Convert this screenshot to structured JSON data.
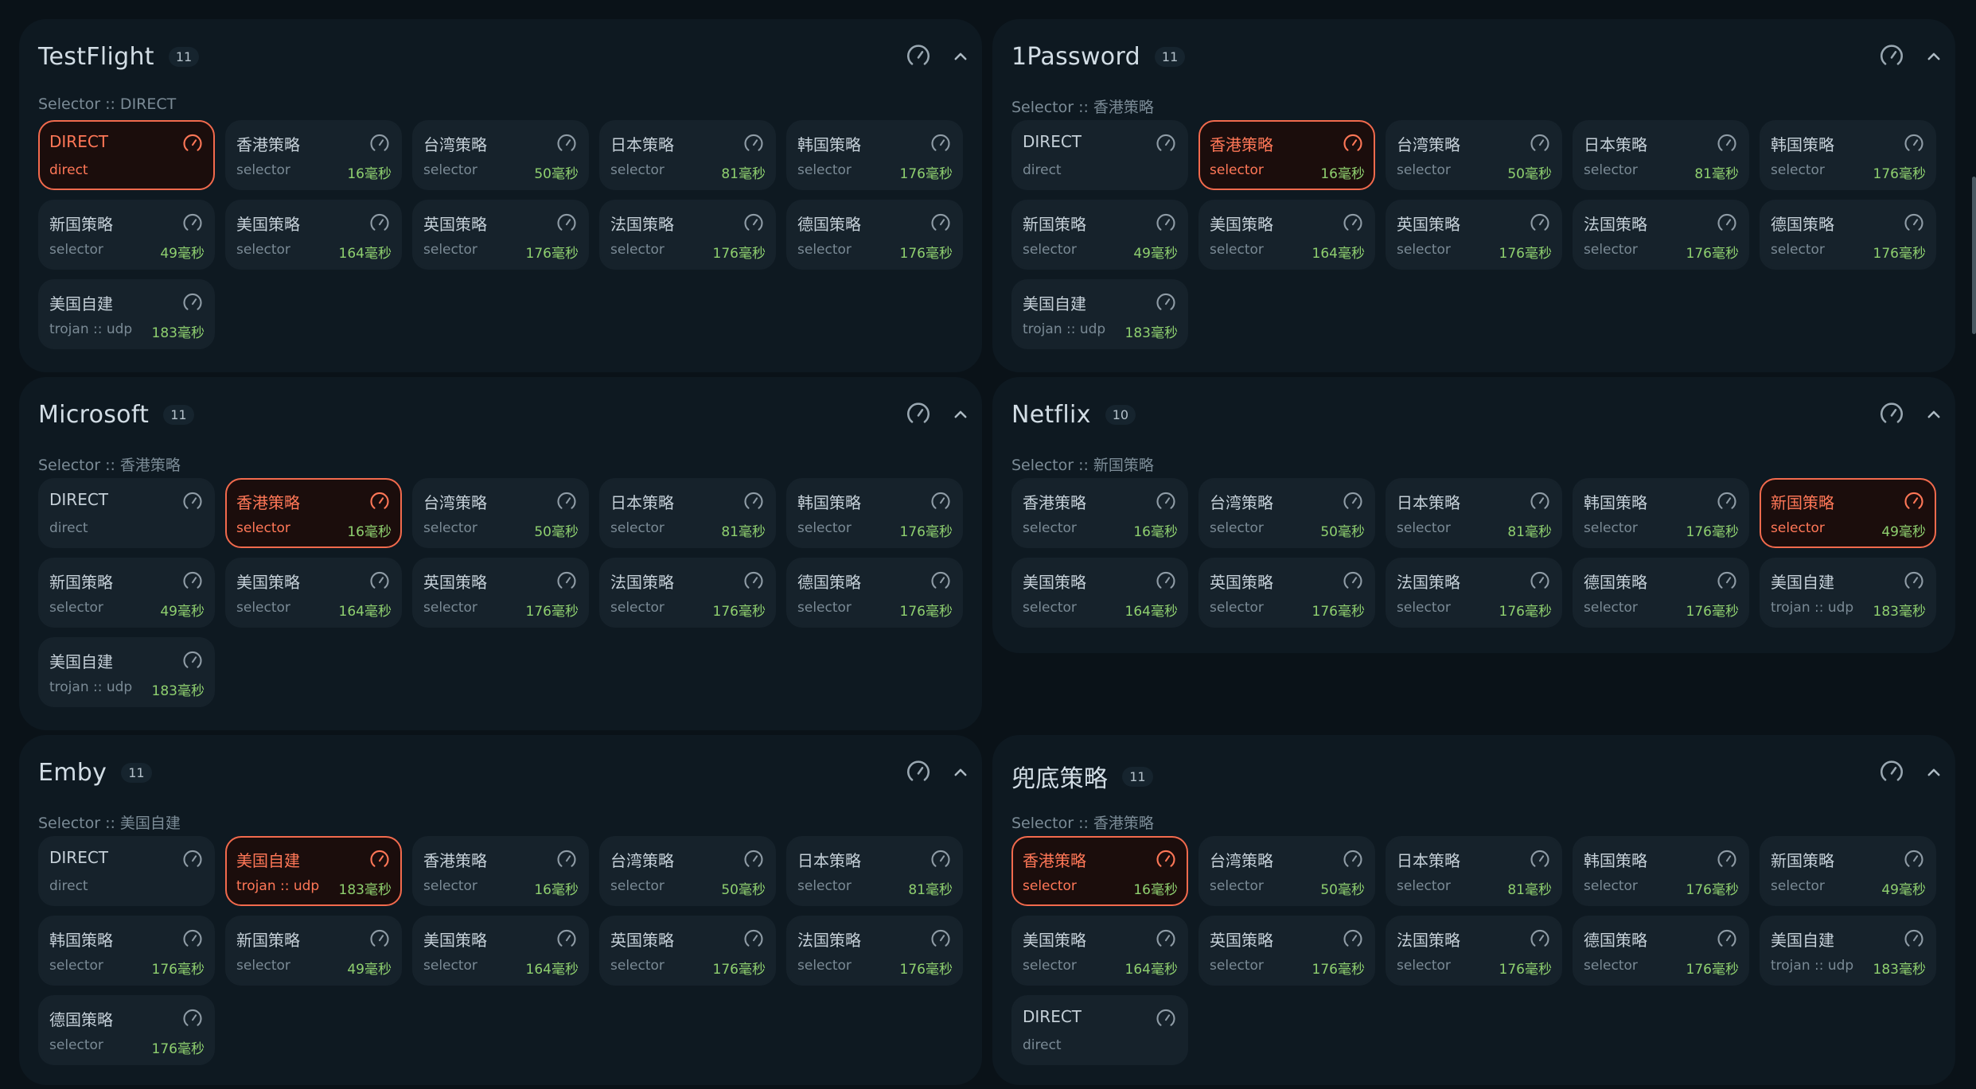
{
  "colors": {
    "background": "#0a1218",
    "panel": "#0e1921",
    "card": "#16222b",
    "selected_border": "#f26a4d",
    "selected_text": "#ff7757",
    "delay_text": "#8fd06f"
  },
  "icons": {
    "speed": "speedometer-icon",
    "collapse": "chevron-up-icon"
  },
  "groups": [
    {
      "title": "TestFlight",
      "count": "11",
      "subtitle": "Selector :: DIRECT",
      "proxies": [
        {
          "name": "DIRECT",
          "type": "direct",
          "delay": "",
          "selected": true
        },
        {
          "name": "香港策略",
          "type": "selector",
          "delay": "16毫秒",
          "selected": false
        },
        {
          "name": "台湾策略",
          "type": "selector",
          "delay": "50毫秒",
          "selected": false
        },
        {
          "name": "日本策略",
          "type": "selector",
          "delay": "81毫秒",
          "selected": false
        },
        {
          "name": "韩国策略",
          "type": "selector",
          "delay": "176毫秒",
          "selected": false
        },
        {
          "name": "新国策略",
          "type": "selector",
          "delay": "49毫秒",
          "selected": false
        },
        {
          "name": "美国策略",
          "type": "selector",
          "delay": "164毫秒",
          "selected": false
        },
        {
          "name": "英国策略",
          "type": "selector",
          "delay": "176毫秒",
          "selected": false
        },
        {
          "name": "法国策略",
          "type": "selector",
          "delay": "176毫秒",
          "selected": false
        },
        {
          "name": "德国策略",
          "type": "selector",
          "delay": "176毫秒",
          "selected": false
        },
        {
          "name": "美国自建",
          "type": "trojan :: udp",
          "delay": "183毫秒",
          "selected": false
        }
      ]
    },
    {
      "title": "1Password",
      "count": "11",
      "subtitle": "Selector :: 香港策略",
      "proxies": [
        {
          "name": "DIRECT",
          "type": "direct",
          "delay": "",
          "selected": false
        },
        {
          "name": "香港策略",
          "type": "selector",
          "delay": "16毫秒",
          "selected": true
        },
        {
          "name": "台湾策略",
          "type": "selector",
          "delay": "50毫秒",
          "selected": false
        },
        {
          "name": "日本策略",
          "type": "selector",
          "delay": "81毫秒",
          "selected": false
        },
        {
          "name": "韩国策略",
          "type": "selector",
          "delay": "176毫秒",
          "selected": false
        },
        {
          "name": "新国策略",
          "type": "selector",
          "delay": "49毫秒",
          "selected": false
        },
        {
          "name": "美国策略",
          "type": "selector",
          "delay": "164毫秒",
          "selected": false
        },
        {
          "name": "英国策略",
          "type": "selector",
          "delay": "176毫秒",
          "selected": false
        },
        {
          "name": "法国策略",
          "type": "selector",
          "delay": "176毫秒",
          "selected": false
        },
        {
          "name": "德国策略",
          "type": "selector",
          "delay": "176毫秒",
          "selected": false
        },
        {
          "name": "美国自建",
          "type": "trojan :: udp",
          "delay": "183毫秒",
          "selected": false
        }
      ]
    },
    {
      "title": "Microsoft",
      "count": "11",
      "subtitle": "Selector :: 香港策略",
      "proxies": [
        {
          "name": "DIRECT",
          "type": "direct",
          "delay": "",
          "selected": false
        },
        {
          "name": "香港策略",
          "type": "selector",
          "delay": "16毫秒",
          "selected": true
        },
        {
          "name": "台湾策略",
          "type": "selector",
          "delay": "50毫秒",
          "selected": false
        },
        {
          "name": "日本策略",
          "type": "selector",
          "delay": "81毫秒",
          "selected": false
        },
        {
          "name": "韩国策略",
          "type": "selector",
          "delay": "176毫秒",
          "selected": false
        },
        {
          "name": "新国策略",
          "type": "selector",
          "delay": "49毫秒",
          "selected": false
        },
        {
          "name": "美国策略",
          "type": "selector",
          "delay": "164毫秒",
          "selected": false
        },
        {
          "name": "英国策略",
          "type": "selector",
          "delay": "176毫秒",
          "selected": false
        },
        {
          "name": "法国策略",
          "type": "selector",
          "delay": "176毫秒",
          "selected": false
        },
        {
          "name": "德国策略",
          "type": "selector",
          "delay": "176毫秒",
          "selected": false
        },
        {
          "name": "美国自建",
          "type": "trojan :: udp",
          "delay": "183毫秒",
          "selected": false
        }
      ]
    },
    {
      "title": "Netflix",
      "count": "10",
      "subtitle": "Selector :: 新国策略",
      "proxies": [
        {
          "name": "香港策略",
          "type": "selector",
          "delay": "16毫秒",
          "selected": false
        },
        {
          "name": "台湾策略",
          "type": "selector",
          "delay": "50毫秒",
          "selected": false
        },
        {
          "name": "日本策略",
          "type": "selector",
          "delay": "81毫秒",
          "selected": false
        },
        {
          "name": "韩国策略",
          "type": "selector",
          "delay": "176毫秒",
          "selected": false
        },
        {
          "name": "新国策略",
          "type": "selector",
          "delay": "49毫秒",
          "selected": true
        },
        {
          "name": "美国策略",
          "type": "selector",
          "delay": "164毫秒",
          "selected": false
        },
        {
          "name": "英国策略",
          "type": "selector",
          "delay": "176毫秒",
          "selected": false
        },
        {
          "name": "法国策略",
          "type": "selector",
          "delay": "176毫秒",
          "selected": false
        },
        {
          "name": "德国策略",
          "type": "selector",
          "delay": "176毫秒",
          "selected": false
        },
        {
          "name": "美国自建",
          "type": "trojan :: udp",
          "delay": "183毫秒",
          "selected": false
        }
      ]
    },
    {
      "title": "Emby",
      "count": "11",
      "subtitle": "Selector :: 美国自建",
      "proxies": [
        {
          "name": "DIRECT",
          "type": "direct",
          "delay": "",
          "selected": false
        },
        {
          "name": "美国自建",
          "type": "trojan :: udp",
          "delay": "183毫秒",
          "selected": true
        },
        {
          "name": "香港策略",
          "type": "selector",
          "delay": "16毫秒",
          "selected": false
        },
        {
          "name": "台湾策略",
          "type": "selector",
          "delay": "50毫秒",
          "selected": false
        },
        {
          "name": "日本策略",
          "type": "selector",
          "delay": "81毫秒",
          "selected": false
        },
        {
          "name": "韩国策略",
          "type": "selector",
          "delay": "176毫秒",
          "selected": false
        },
        {
          "name": "新国策略",
          "type": "selector",
          "delay": "49毫秒",
          "selected": false
        },
        {
          "name": "美国策略",
          "type": "selector",
          "delay": "164毫秒",
          "selected": false
        },
        {
          "name": "英国策略",
          "type": "selector",
          "delay": "176毫秒",
          "selected": false
        },
        {
          "name": "法国策略",
          "type": "selector",
          "delay": "176毫秒",
          "selected": false
        },
        {
          "name": "德国策略",
          "type": "selector",
          "delay": "176毫秒",
          "selected": false
        }
      ]
    },
    {
      "title": "兜底策略",
      "count": "11",
      "subtitle": "Selector :: 香港策略",
      "proxies": [
        {
          "name": "香港策略",
          "type": "selector",
          "delay": "16毫秒",
          "selected": true
        },
        {
          "name": "台湾策略",
          "type": "selector",
          "delay": "50毫秒",
          "selected": false
        },
        {
          "name": "日本策略",
          "type": "selector",
          "delay": "81毫秒",
          "selected": false
        },
        {
          "name": "韩国策略",
          "type": "selector",
          "delay": "176毫秒",
          "selected": false
        },
        {
          "name": "新国策略",
          "type": "selector",
          "delay": "49毫秒",
          "selected": false
        },
        {
          "name": "美国策略",
          "type": "selector",
          "delay": "164毫秒",
          "selected": false
        },
        {
          "name": "英国策略",
          "type": "selector",
          "delay": "176毫秒",
          "selected": false
        },
        {
          "name": "法国策略",
          "type": "selector",
          "delay": "176毫秒",
          "selected": false
        },
        {
          "name": "德国策略",
          "type": "selector",
          "delay": "176毫秒",
          "selected": false
        },
        {
          "name": "美国自建",
          "type": "trojan :: udp",
          "delay": "183毫秒",
          "selected": false
        },
        {
          "name": "DIRECT",
          "type": "direct",
          "delay": "",
          "selected": false
        }
      ]
    }
  ]
}
